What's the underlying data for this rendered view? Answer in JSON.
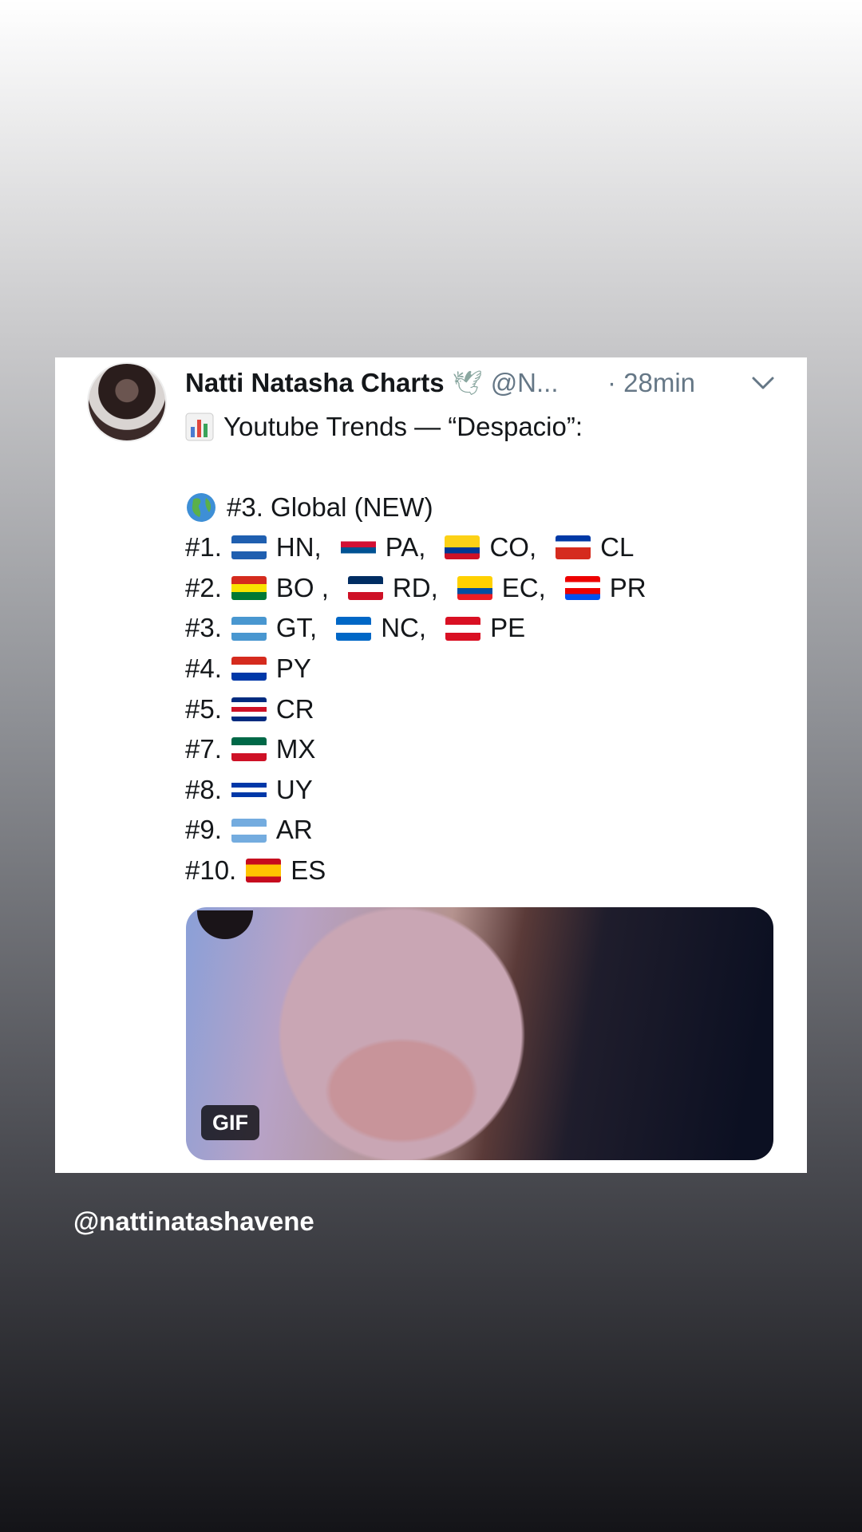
{
  "tweet": {
    "author": "Natti Natasha Charts",
    "handle": "@N...",
    "time": "· 28min",
    "intro": "Youtube Trends — “Despacio”:",
    "global": "#3. Global (NEW)",
    "rankings": [
      {
        "rank": "#1.",
        "entries": [
          {
            "code": "HN,",
            "flag": [
              "#1f5fb0",
              "#ffffff",
              "#1f5fb0"
            ]
          },
          {
            "code": "PA,",
            "flag": [
              "#ffffff",
              "#d21034",
              "#005293",
              "#ffffff"
            ]
          },
          {
            "code": "CO,",
            "flag": [
              "#fcd116",
              "#fcd116",
              "#003893",
              "#ce1126"
            ]
          },
          {
            "code": "CL",
            "flag": [
              "#0039a6",
              "#ffffff",
              "#d52b1e",
              "#d52b1e"
            ]
          }
        ]
      },
      {
        "rank": "#2.",
        "entries": [
          {
            "code": "BO ,",
            "flag": [
              "#d52b1e",
              "#f9e300",
              "#007934"
            ]
          },
          {
            "code": "RD,",
            "flag": [
              "#002d62",
              "#ffffff",
              "#ce1126"
            ]
          },
          {
            "code": "EC,",
            "flag": [
              "#ffd100",
              "#ffd100",
              "#034ea2",
              "#ed1c24"
            ]
          },
          {
            "code": "PR",
            "flag": [
              "#ed0000",
              "#ffffff",
              "#ed0000",
              "#0050f0"
            ]
          }
        ]
      },
      {
        "rank": "#3.",
        "entries": [
          {
            "code": "GT,",
            "flag": [
              "#4997d0",
              "#ffffff",
              "#4997d0"
            ]
          },
          {
            "code": "NC,",
            "flag": [
              "#0067c6",
              "#ffffff",
              "#0067c6"
            ]
          },
          {
            "code": "PE",
            "flag": [
              "#d91023",
              "#ffffff",
              "#d91023"
            ]
          }
        ]
      },
      {
        "rank": "#4.",
        "entries": [
          {
            "code": "PY",
            "flag": [
              "#d52b1e",
              "#ffffff",
              "#0038a8"
            ]
          }
        ]
      },
      {
        "rank": "#5.",
        "entries": [
          {
            "code": "CR",
            "flag": [
              "#002b7f",
              "#ffffff",
              "#ce1126",
              "#ffffff",
              "#002b7f"
            ]
          }
        ]
      },
      {
        "rank": "#7.",
        "entries": [
          {
            "code": "MX",
            "flag": [
              "#006847",
              "#ffffff",
              "#ce1126"
            ]
          }
        ]
      },
      {
        "rank": "#8.",
        "entries": [
          {
            "code": "UY",
            "flag": [
              "#ffffff",
              "#0038a8",
              "#ffffff",
              "#0038a8",
              "#ffffff"
            ]
          }
        ]
      },
      {
        "rank": "#9.",
        "entries": [
          {
            "code": "AR",
            "flag": [
              "#74acdf",
              "#ffffff",
              "#74acdf"
            ]
          }
        ]
      },
      {
        "rank": "#10.",
        "entries": [
          {
            "code": "ES",
            "flag": [
              "#c60b1e",
              "#ffc400",
              "#ffc400",
              "#c60b1e"
            ]
          }
        ]
      }
    ],
    "media_badge": "GIF"
  },
  "story": {
    "credit": "@nattinatashavene"
  },
  "icons": {
    "verified_like_badge": "dove-icon",
    "chart": "bar-chart-icon",
    "globe": "globe-icon",
    "menu": "chevron-down-icon"
  }
}
